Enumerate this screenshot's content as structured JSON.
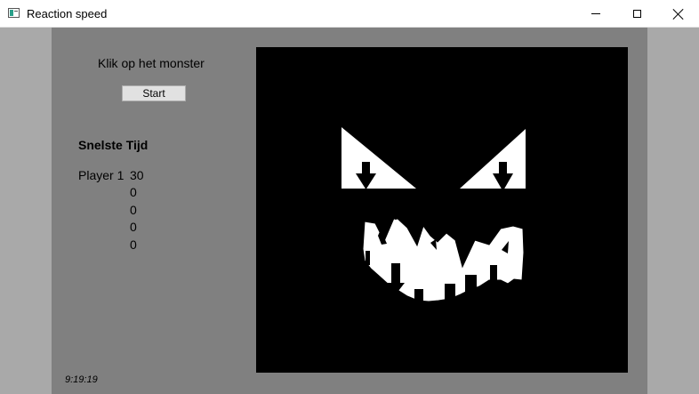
{
  "window": {
    "title": "Reaction speed"
  },
  "instruction": "Klik op het monster",
  "start_button": "Start",
  "scoreboard": {
    "title": "Snelste Tijd",
    "player": "Player 1",
    "scores": [
      "30",
      "0",
      "0",
      "0",
      "0"
    ]
  },
  "clock": "9:19:19",
  "colors": {
    "panel": "#808080",
    "game_bg": "#000000",
    "monster": "#ffffff"
  },
  "game": {
    "monster_icon": "monster-face-icon"
  }
}
